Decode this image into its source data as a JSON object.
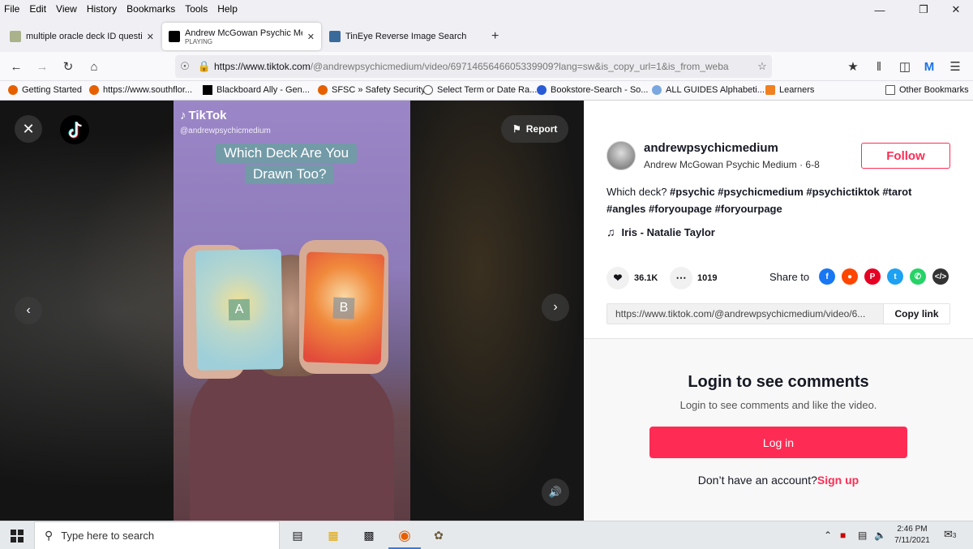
{
  "menubar": {
    "items": [
      "File",
      "Edit",
      "View",
      "History",
      "Bookmarks",
      "Tools",
      "Help"
    ]
  },
  "tabs": [
    {
      "title": "multiple oracle deck ID questio",
      "sub": ""
    },
    {
      "title": "Andrew McGowan Psychic Med",
      "sub": "PLAYING"
    },
    {
      "title": "TinEye Reverse Image Search",
      "sub": ""
    }
  ],
  "navbar": {
    "url_host": "https://www.tiktok.com",
    "url_rest": "/@andrewpsychicmedium/video/6971465646605339909?lang=sw&is_copy_url=1&is_from_weba"
  },
  "bookmarks": [
    "Getting Started",
    "https://www.southflor...",
    "Blackboard Ally - Gen...",
    "SFSC » Safety Security",
    "Select Term or Date Ra...",
    "Bookstore-Search - So...",
    "ALL GUIDES Alphabeti...",
    "Learners",
    "Other Bookmarks"
  ],
  "video": {
    "brand": "TikTok",
    "handle": "@andrewpsychicmedium",
    "caption_line1": "Which Deck Are You",
    "caption_line2": "Drawn Too?",
    "card_a": "A",
    "card_b": "B",
    "report": "Report"
  },
  "post": {
    "username": "andrewpsychicmedium",
    "fullname": "Andrew McGowan Psychic Medium · 6-8",
    "follow": "Follow",
    "desc_text": "Which deck?",
    "tags_line1": "#psychic #psychicmedium #psychictiktok #tarot",
    "tags_line2": "#angles #foryoupage #foryourpage",
    "music": "Iris - Natalie Taylor",
    "likes": "36.1K",
    "comments": "1019",
    "share_to": "Share to",
    "link": "https://www.tiktok.com/@andrewpsychicmedium/video/6...",
    "copy_link": "Copy link"
  },
  "login": {
    "title": "Login to see comments",
    "subtitle": "Login to see comments and like the video.",
    "button": "Log in",
    "no_account": "Don’t have an account?",
    "signup": "Sign up"
  },
  "taskbar": {
    "search_placeholder": "Type here to search",
    "time": "2:46 PM",
    "date": "7/11/2021",
    "notifications": "3"
  },
  "colors": {
    "accent": "#fe2c55",
    "video_bg": "#9b86c7"
  }
}
